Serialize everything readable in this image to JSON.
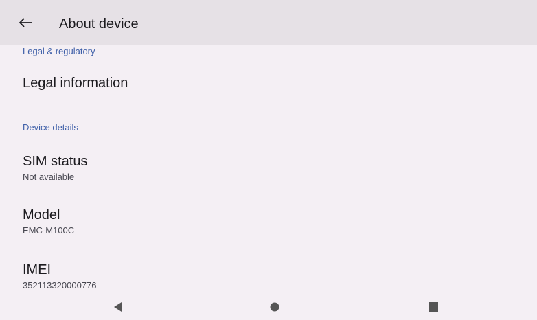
{
  "header": {
    "title": "About device",
    "back_icon": "arrow-back-icon"
  },
  "sections": {
    "legal_header": "Legal & regulatory",
    "legal_information": "Legal information",
    "device_header": "Device details",
    "sim_status_title": "SIM status",
    "sim_status_summary": "Not available",
    "model_title": "Model",
    "model_summary": "EMC-M100C",
    "imei_title": "IMEI",
    "imei_summary": "352113320000776"
  },
  "navbar": {
    "back_icon": "nav-back-icon",
    "home_icon": "nav-home-icon",
    "recents_icon": "nav-recents-icon"
  },
  "colors": {
    "background": "#f4eff4",
    "toolbar": "#e6e1e6",
    "section_header": "#3e5fa8",
    "primary_text": "#1c1b1f",
    "secondary_text": "#46464f"
  }
}
